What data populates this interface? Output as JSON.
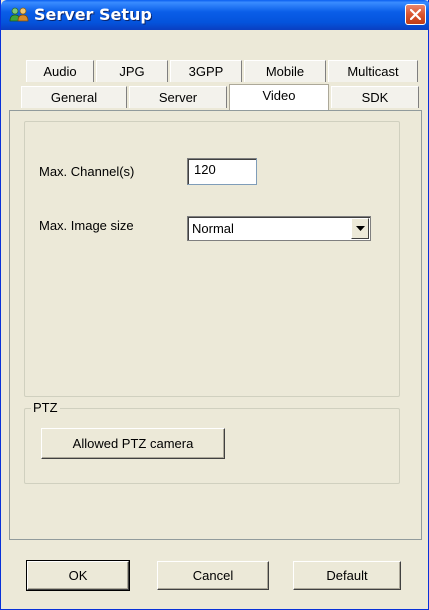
{
  "window": {
    "title": "Server Setup",
    "close_icon": "close-icon"
  },
  "tabs": {
    "row_top": [
      {
        "label": "Audio"
      },
      {
        "label": "JPG"
      },
      {
        "label": "3GPP"
      },
      {
        "label": "Mobile"
      },
      {
        "label": "Multicast"
      }
    ],
    "row_bottom": [
      {
        "label": "General"
      },
      {
        "label": "Server"
      },
      {
        "label": "Video",
        "selected": true
      },
      {
        "label": "SDK"
      }
    ]
  },
  "video": {
    "max_channels_label": "Max. Channel(s)",
    "max_channels_value": "120",
    "max_image_size_label": "Max. Image size",
    "max_image_size_value": "Normal"
  },
  "ptz": {
    "group_label": "PTZ",
    "allowed_button": "Allowed PTZ camera"
  },
  "footer": {
    "ok": "OK",
    "cancel": "Cancel",
    "default": "Default"
  },
  "colors": {
    "titlebar": "#0453dc",
    "window_bg": "#ece9d8",
    "close_button": "#d9542f"
  }
}
